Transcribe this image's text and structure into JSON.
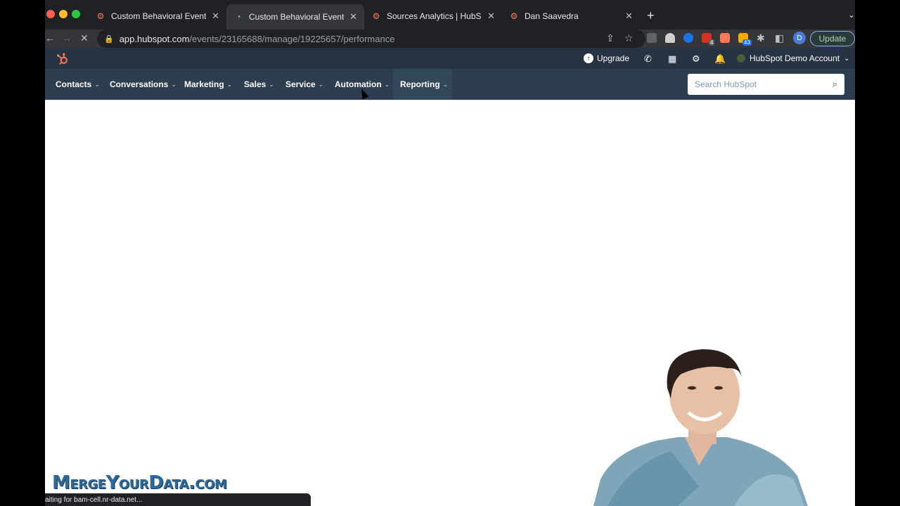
{
  "browser": {
    "tabs": [
      {
        "title": "Custom Behavioral Events | Hu",
        "favicon": "hubspot-sprocket-icon",
        "active": false
      },
      {
        "title": "Custom Behavioral Events | Hu",
        "favicon": "loading-spinner-icon",
        "active": true
      },
      {
        "title": "Sources Analytics | HubSpot",
        "favicon": "hubspot-sprocket-icon",
        "active": false
      },
      {
        "title": "Dan Saavedra",
        "favicon": "hubspot-sprocket-icon",
        "active": false
      }
    ],
    "url_domain": "app.hubspot.com",
    "url_path": "/events/23165688/manage/19225657/performance",
    "profile_initial": "D",
    "update_label": "Update",
    "extension_badges": [
      "4",
      "43"
    ]
  },
  "hubspot": {
    "top": {
      "upgrade_label": "Upgrade",
      "account_name": "HubSpot Demo Account"
    },
    "nav": {
      "items": [
        "Contacts",
        "Conversations",
        "Marketing",
        "Sales",
        "Service",
        "Automation",
        "Reporting"
      ]
    },
    "search": {
      "placeholder": "Search HubSpot"
    }
  },
  "status_bar": {
    "text": "aiting for bam-cell.nr-data.net..."
  },
  "watermark": {
    "text": "MergeYourData.com"
  },
  "colors": {
    "hs_top": "#253342",
    "hs_nav": "#2d3e50",
    "hs_accent": "#ff7a59"
  }
}
